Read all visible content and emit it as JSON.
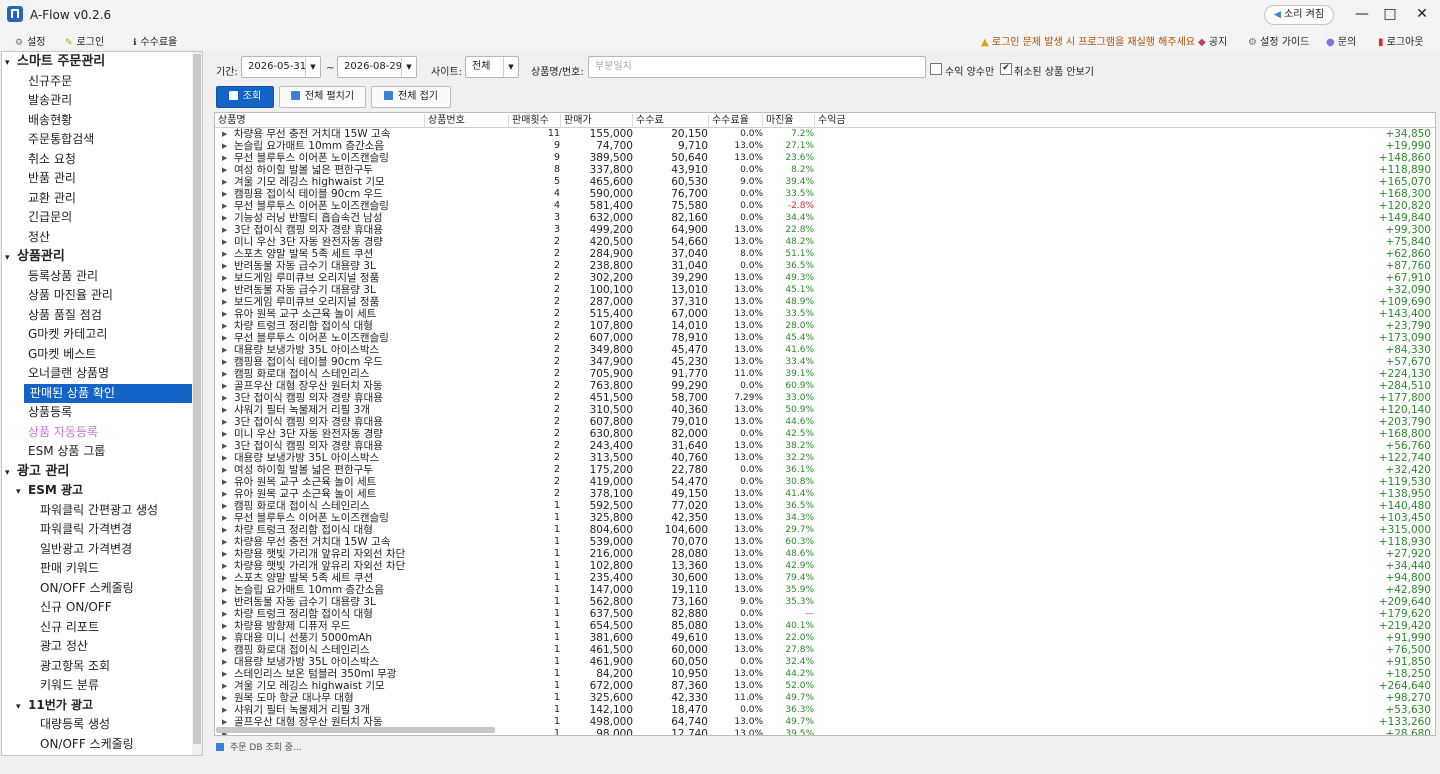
{
  "app": {
    "title": "A-Flow v0.2.6",
    "sound_button": "소리 켜짐"
  },
  "window_controls": {
    "minimize": "—",
    "maximize": "□",
    "close": "✕"
  },
  "menu": {
    "settings": "설정",
    "login": "로그인",
    "fees": "수수료율"
  },
  "toplinks": {
    "notice": "로그인 문제 발생 시 프로그램을 재실행 해주세요",
    "announce": "공지",
    "guide": "설정 가이드",
    "inquiry": "문의",
    "logout": "로그아웃"
  },
  "sidebar": [
    {
      "label": "스마트 주문관리",
      "kind": "cat"
    },
    {
      "label": "신규주문",
      "kind": "item"
    },
    {
      "label": "발송관리",
      "kind": "item"
    },
    {
      "label": "배송현황",
      "kind": "item"
    },
    {
      "label": "주문통합검색",
      "kind": "item"
    },
    {
      "label": "취소 요청",
      "kind": "item"
    },
    {
      "label": "반품 관리",
      "kind": "item"
    },
    {
      "label": "교환 관리",
      "kind": "item"
    },
    {
      "label": "긴급문의",
      "kind": "item"
    },
    {
      "label": "정산",
      "kind": "item"
    },
    {
      "label": "상품관리",
      "kind": "cat"
    },
    {
      "label": "등록상품 관리",
      "kind": "item"
    },
    {
      "label": "상품 마진율 관리",
      "kind": "item"
    },
    {
      "label": "상품 품질 점검",
      "kind": "item"
    },
    {
      "label": "G마켓 카테고리",
      "kind": "item"
    },
    {
      "label": "G마켓 베스트",
      "kind": "item"
    },
    {
      "label": "오너클랜 상품명",
      "kind": "item"
    },
    {
      "label": "판매된 상품 확인",
      "kind": "item",
      "selected": true
    },
    {
      "label": "상품등록",
      "kind": "item"
    },
    {
      "label": "상품 자동등록",
      "kind": "item",
      "pink": true
    },
    {
      "label": "ESM 상품 그룹",
      "kind": "item"
    },
    {
      "label": "광고 관리",
      "kind": "cat"
    },
    {
      "label": "ESM 광고",
      "kind": "sub"
    },
    {
      "label": "파워클릭 간편광고 생성",
      "kind": "item2"
    },
    {
      "label": "파워클릭 가격변경",
      "kind": "item2"
    },
    {
      "label": "일반광고 가격변경",
      "kind": "item2"
    },
    {
      "label": "판매 키워드",
      "kind": "item2"
    },
    {
      "label": "ON/OFF 스케줄링",
      "kind": "item2"
    },
    {
      "label": "신규 ON/OFF",
      "kind": "item2"
    },
    {
      "label": "신규 리포트",
      "kind": "item2"
    },
    {
      "label": "광고 정산",
      "kind": "item2"
    },
    {
      "label": "광고항목 조회",
      "kind": "item2"
    },
    {
      "label": "키워드 분류",
      "kind": "item2"
    },
    {
      "label": "11번가 광고",
      "kind": "sub"
    },
    {
      "label": "대량등록 생성",
      "kind": "item2"
    },
    {
      "label": "ON/OFF 스케줄링",
      "kind": "item2"
    }
  ],
  "filters": {
    "period_label": "기간:",
    "start_date": "2026-05-31",
    "tilde": "~",
    "end_date": "2026-08-29",
    "site_label": "사이트:",
    "site_value": "전체",
    "product_label": "상품명/번호:",
    "product_placeholder": "부분일치",
    "profit_only_label": "수익 양수만",
    "profit_only_checked": false,
    "hide_cancel_label": "취소된 상품 안보기",
    "hide_cancel_checked": true
  },
  "buttons": {
    "search": "조회",
    "expand_all": "전체 펼치기",
    "collapse_all": "전체 접기"
  },
  "table": {
    "columns": [
      "상품명",
      "상품번호",
      "판매횟수",
      "판매가",
      "수수료",
      "수수료율",
      "마진율",
      "수익금"
    ],
    "rows": [
      [
        "차량용 무선 충전 거치대 15W 고속",
        "11",
        "155,000",
        "20,150",
        "0.0%",
        "7.2%",
        "+34,850"
      ],
      [
        "논슬립 요가매트 10mm 층간소음",
        "9",
        "74,700",
        "9,710",
        "13.0%",
        "27.1%",
        "+19,990"
      ],
      [
        "무선 블루투스 이어폰 노이즈캔슬링",
        "9",
        "389,500",
        "50,640",
        "13.0%",
        "23.6%",
        "+148,860"
      ],
      [
        "여성 하이힐 발볼 넓은 편한구두",
        "8",
        "337,800",
        "43,910",
        "0.0%",
        "8.2%",
        "+118,890"
      ],
      [
        "겨울 기모 레깅스 highwaist 기모",
        "5",
        "465,600",
        "60,530",
        "9.0%",
        "39.4%",
        "+165,070"
      ],
      [
        "캠핑용 접이식 테이블 90cm 우드",
        "4",
        "590,000",
        "76,700",
        "0.0%",
        "33.5%",
        "+168,300"
      ],
      [
        "무선 블루투스 이어폰 노이즈캔슬링",
        "4",
        "581,400",
        "75,580",
        "0.0%",
        "-2.8%",
        "+120,820"
      ],
      [
        "기능성 러닝 반팔티 흡습속건 남성",
        "3",
        "632,000",
        "82,160",
        "0.0%",
        "34.4%",
        "+149,840"
      ],
      [
        "3단 접이식 캠핑 의자 경량 휴대용",
        "3",
        "499,200",
        "64,900",
        "13.0%",
        "22.8%",
        "+99,300"
      ],
      [
        "미니 우산 3단 자동 완전자동 경량",
        "2",
        "420,500",
        "54,660",
        "13.0%",
        "48.2%",
        "+75,840"
      ],
      [
        "스포츠 양말 발목 5족 세트 쿠션",
        "2",
        "284,900",
        "37,040",
        "8.0%",
        "51.1%",
        "+62,860"
      ],
      [
        "반려동물 자동 급수기 대용량 3L",
        "2",
        "238,800",
        "31,040",
        "0.0%",
        "36.5%",
        "+87,760"
      ],
      [
        "보드게임 루미큐브 오리지널 정품",
        "2",
        "302,200",
        "39,290",
        "13.0%",
        "49.3%",
        "+67,910"
      ],
      [
        "반려동물 자동 급수기 대용량 3L",
        "2",
        "100,100",
        "13,010",
        "13.0%",
        "45.1%",
        "+32,090"
      ],
      [
        "보드게임 루미큐브 오리지널 정품",
        "2",
        "287,000",
        "37,310",
        "13.0%",
        "48.9%",
        "+109,690"
      ],
      [
        "유아 원목 교구 소근육 놀이 세트",
        "2",
        "515,400",
        "67,000",
        "13.0%",
        "33.5%",
        "+143,400"
      ],
      [
        "차량 트렁크 정리함 접이식 대형",
        "2",
        "107,800",
        "14,010",
        "13.0%",
        "28.0%",
        "+23,790"
      ],
      [
        "무선 블루투스 이어폰 노이즈캔슬링",
        "2",
        "607,000",
        "78,910",
        "13.0%",
        "45.4%",
        "+173,090"
      ],
      [
        "대용량 보냉가방 35L 아이스박스",
        "2",
        "349,800",
        "45,470",
        "13.0%",
        "41.6%",
        "+84,330"
      ],
      [
        "캠핑용 접이식 테이블 90cm 우드",
        "2",
        "347,900",
        "45,230",
        "13.0%",
        "33.4%",
        "+57,670"
      ],
      [
        "캠핑 화로대 접이식 스테인리스",
        "2",
        "705,900",
        "91,770",
        "11.0%",
        "39.1%",
        "+224,130"
      ],
      [
        "골프우산 대형 장우산 원터치 자동",
        "2",
        "763,800",
        "99,290",
        "0.0%",
        "60.9%",
        "+284,510"
      ],
      [
        "3단 접이식 캠핑 의자 경량 휴대용",
        "2",
        "451,500",
        "58,700",
        "7.29%",
        "33.0%",
        "+177,800"
      ],
      [
        "샤워기 필터 녹물제거 리필 3개",
        "2",
        "310,500",
        "40,360",
        "13.0%",
        "50.9%",
        "+120,140"
      ],
      [
        "3단 접이식 캠핑 의자 경량 휴대용",
        "2",
        "607,800",
        "79,010",
        "13.0%",
        "44.6%",
        "+203,790"
      ],
      [
        "미니 우산 3단 자동 완전자동 경량",
        "2",
        "630,800",
        "82,000",
        "0.0%",
        "42.5%",
        "+168,800"
      ],
      [
        "3단 접이식 캠핑 의자 경량 휴대용",
        "2",
        "243,400",
        "31,640",
        "13.0%",
        "38.2%",
        "+56,760"
      ],
      [
        "대용량 보냉가방 35L 아이스박스",
        "2",
        "313,500",
        "40,760",
        "13.0%",
        "32.2%",
        "+122,740"
      ],
      [
        "여성 하이힐 발볼 넓은 편한구두",
        "2",
        "175,200",
        "22,780",
        "0.0%",
        "36.1%",
        "+32,420"
      ],
      [
        "유아 원목 교구 소근육 놀이 세트",
        "2",
        "419,000",
        "54,470",
        "0.0%",
        "30.8%",
        "+119,530"
      ],
      [
        "유아 원목 교구 소근육 놀이 세트",
        "2",
        "378,100",
        "49,150",
        "13.0%",
        "41.4%",
        "+138,950"
      ],
      [
        "캠핑 화로대 접이식 스테인리스",
        "1",
        "592,500",
        "77,020",
        "13.0%",
        "36.5%",
        "+140,480"
      ],
      [
        "무선 블루투스 이어폰 노이즈캔슬링",
        "1",
        "325,800",
        "42,350",
        "13.0%",
        "34.3%",
        "+103,450"
      ],
      [
        "차량 트렁크 정리함 접이식 대형",
        "1",
        "804,600",
        "104,600",
        "13.0%",
        "29.7%",
        "+315,000"
      ],
      [
        "차량용 무선 충전 거치대 15W 고속",
        "1",
        "539,000",
        "70,070",
        "13.0%",
        "60.3%",
        "+118,930"
      ],
      [
        "차량용 햇빛 가리개 앞유리 자외선 차단",
        "1",
        "216,000",
        "28,080",
        "13.0%",
        "48.6%",
        "+27,920"
      ],
      [
        "차량용 햇빛 가리개 앞유리 자외선 차단",
        "1",
        "102,800",
        "13,360",
        "13.0%",
        "42.9%",
        "+34,440"
      ],
      [
        "스포츠 양말 발목 5족 세트 쿠션",
        "1",
        "235,400",
        "30,600",
        "13.0%",
        "79.4%",
        "+94,800"
      ],
      [
        "논슬립 요가매트 10mm 층간소음",
        "1",
        "147,000",
        "19,110",
        "13.0%",
        "35.9%",
        "+42,890"
      ],
      [
        "반려동물 자동 급수기 대용량 3L",
        "1",
        "562,800",
        "73,160",
        "9.0%",
        "35.3%",
        "+209,640"
      ],
      [
        "차량 트렁크 정리함 접이식 대형",
        "1",
        "637,500",
        "82,880",
        "0.0%",
        "—",
        "+179,620"
      ],
      [
        "차량용 방향제 디퓨저 우드",
        "1",
        "654,500",
        "85,080",
        "13.0%",
        "40.1%",
        "+219,420"
      ],
      [
        "휴대용 미니 선풍기 5000mAh",
        "1",
        "381,600",
        "49,610",
        "13.0%",
        "22.0%",
        "+91,990"
      ],
      [
        "캠핑 화로대 접이식 스테인리스",
        "1",
        "461,500",
        "60,000",
        "13.0%",
        "27.8%",
        "+76,500"
      ],
      [
        "대용량 보냉가방 35L 아이스박스",
        "1",
        "461,900",
        "60,050",
        "0.0%",
        "32.4%",
        "+91,850"
      ],
      [
        "스테인리스 보온 텀블러 350ml 무광",
        "1",
        "84,200",
        "10,950",
        "13.0%",
        "44.2%",
        "+18,250"
      ],
      [
        "겨울 기모 레깅스 highwaist 기모",
        "1",
        "672,000",
        "87,360",
        "13.0%",
        "52.0%",
        "+264,640"
      ],
      [
        "원목 도마 항균 대나무 대형",
        "1",
        "325,600",
        "42,330",
        "11.0%",
        "49.7%",
        "+98,270"
      ],
      [
        "샤워기 필터 녹물제거 리필 3개",
        "1",
        "142,100",
        "18,470",
        "0.0%",
        "36.3%",
        "+53,630"
      ],
      [
        "골프우산 대형 장우산 원터치 자동",
        "1",
        "498,000",
        "64,740",
        "13.0%",
        "49.7%",
        "+133,260"
      ],
      [
        "",
        "1",
        "98,000",
        "12,740",
        "13.0%",
        "39.5%",
        "+28,680"
      ]
    ]
  },
  "status": {
    "text": "주문 DB 조회 중..."
  },
  "colors": {
    "accent": "#1464c8",
    "positive": "#2a8a2a",
    "negative": "#d03030",
    "pink_item": "#c77bcf",
    "notice": "#b45000"
  }
}
